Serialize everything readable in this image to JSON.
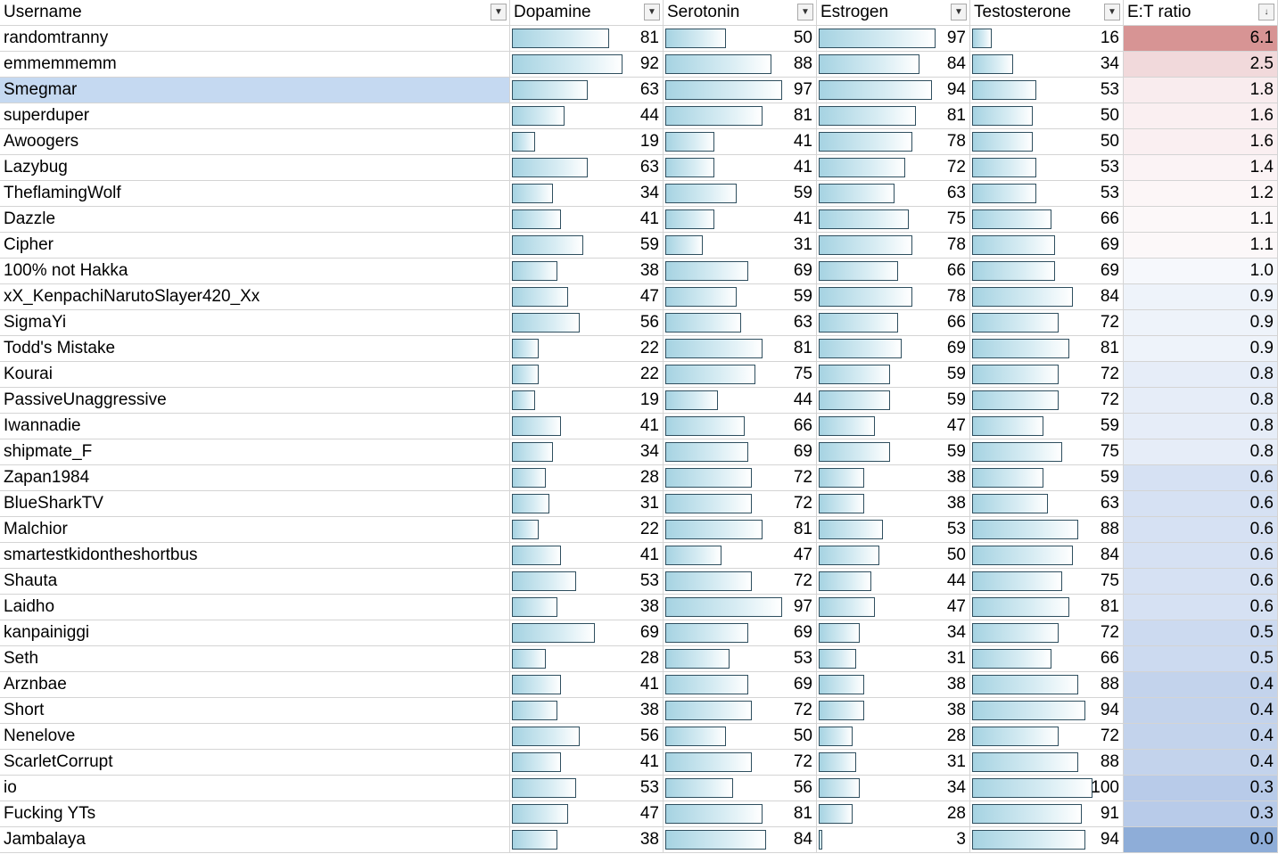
{
  "headers": {
    "username": "Username",
    "dopamine": "Dopamine",
    "serotonin": "Serotonin",
    "estrogen": "Estrogen",
    "testosterone": "Testosterone",
    "ratio": "E:T ratio"
  },
  "icons": {
    "filter": "dropdown-arrow-icon",
    "sort_desc": "sort-descending-icon"
  },
  "colors": {
    "selected_row": "#c5d9f1",
    "ratio_high": "#d79494",
    "ratio_mid": "#fbf8f9",
    "ratio_low": "#8eadd8"
  },
  "rows": [
    {
      "user": "randomtranny",
      "dopamine": 81,
      "serotonin": 50,
      "estrogen": 97,
      "testosterone": 16,
      "ratio": "6.1",
      "ratio_color": "#d79494"
    },
    {
      "user": "emmemmemm",
      "dopamine": 92,
      "serotonin": 88,
      "estrogen": 84,
      "testosterone": 34,
      "ratio": "2.5",
      "ratio_color": "#f1d9db"
    },
    {
      "user": "Smegmar",
      "dopamine": 63,
      "serotonin": 97,
      "estrogen": 94,
      "testosterone": 53,
      "ratio": "1.8",
      "ratio_color": "#f9ecee",
      "selected": true
    },
    {
      "user": "superduper",
      "dopamine": 44,
      "serotonin": 81,
      "estrogen": 81,
      "testosterone": 50,
      "ratio": "1.6",
      "ratio_color": "#faeff1"
    },
    {
      "user": "Awoogers",
      "dopamine": 19,
      "serotonin": 41,
      "estrogen": 78,
      "testosterone": 50,
      "ratio": "1.6",
      "ratio_color": "#faeff1"
    },
    {
      "user": "Lazybug",
      "dopamine": 63,
      "serotonin": 41,
      "estrogen": 72,
      "testosterone": 53,
      "ratio": "1.4",
      "ratio_color": "#fbf3f5"
    },
    {
      "user": "TheflamingWolf",
      "dopamine": 34,
      "serotonin": 59,
      "estrogen": 63,
      "testosterone": 53,
      "ratio": "1.2",
      "ratio_color": "#fcf6f7"
    },
    {
      "user": "Dazzle",
      "dopamine": 41,
      "serotonin": 41,
      "estrogen": 75,
      "testosterone": 66,
      "ratio": "1.1",
      "ratio_color": "#fcf8f9"
    },
    {
      "user": "Cipher",
      "dopamine": 59,
      "serotonin": 31,
      "estrogen": 78,
      "testosterone": 69,
      "ratio": "1.1",
      "ratio_color": "#fcf8f9"
    },
    {
      "user": "100% not Hakka",
      "dopamine": 38,
      "serotonin": 69,
      "estrogen": 66,
      "testosterone": 69,
      "ratio": "1.0",
      "ratio_color": "#f6f8fc"
    },
    {
      "user": "xX_KenpachiNarutoSlayer420_Xx",
      "dopamine": 47,
      "serotonin": 59,
      "estrogen": 78,
      "testosterone": 84,
      "ratio": "0.9",
      "ratio_color": "#eef3fa"
    },
    {
      "user": "SigmaYi",
      "dopamine": 56,
      "serotonin": 63,
      "estrogen": 66,
      "testosterone": 72,
      "ratio": "0.9",
      "ratio_color": "#eef3fa"
    },
    {
      "user": "Todd's Mistake",
      "dopamine": 22,
      "serotonin": 81,
      "estrogen": 69,
      "testosterone": 81,
      "ratio": "0.9",
      "ratio_color": "#eef3fa"
    },
    {
      "user": "Kourai",
      "dopamine": 22,
      "serotonin": 75,
      "estrogen": 59,
      "testosterone": 72,
      "ratio": "0.8",
      "ratio_color": "#e6edf8"
    },
    {
      "user": "PassiveUnaggressive",
      "dopamine": 19,
      "serotonin": 44,
      "estrogen": 59,
      "testosterone": 72,
      "ratio": "0.8",
      "ratio_color": "#e6edf8"
    },
    {
      "user": "Iwannadie",
      "dopamine": 41,
      "serotonin": 66,
      "estrogen": 47,
      "testosterone": 59,
      "ratio": "0.8",
      "ratio_color": "#e6edf8"
    },
    {
      "user": "shipmate_F",
      "dopamine": 34,
      "serotonin": 69,
      "estrogen": 59,
      "testosterone": 75,
      "ratio": "0.8",
      "ratio_color": "#e6edf8"
    },
    {
      "user": "Zapan1984",
      "dopamine": 28,
      "serotonin": 72,
      "estrogen": 38,
      "testosterone": 59,
      "ratio": "0.6",
      "ratio_color": "#d6e1f3"
    },
    {
      "user": "BlueSharkTV",
      "dopamine": 31,
      "serotonin": 72,
      "estrogen": 38,
      "testosterone": 63,
      "ratio": "0.6",
      "ratio_color": "#d6e1f3"
    },
    {
      "user": "Malchior",
      "dopamine": 22,
      "serotonin": 81,
      "estrogen": 53,
      "testosterone": 88,
      "ratio": "0.6",
      "ratio_color": "#d6e1f3"
    },
    {
      "user": "smartestkidontheshortbus",
      "dopamine": 41,
      "serotonin": 47,
      "estrogen": 50,
      "testosterone": 84,
      "ratio": "0.6",
      "ratio_color": "#d6e1f3"
    },
    {
      "user": "Shauta",
      "dopamine": 53,
      "serotonin": 72,
      "estrogen": 44,
      "testosterone": 75,
      "ratio": "0.6",
      "ratio_color": "#d6e1f3"
    },
    {
      "user": "Laidho",
      "dopamine": 38,
      "serotonin": 97,
      "estrogen": 47,
      "testosterone": 81,
      "ratio": "0.6",
      "ratio_color": "#d6e1f3"
    },
    {
      "user": "kanpainiggi",
      "dopamine": 69,
      "serotonin": 69,
      "estrogen": 34,
      "testosterone": 72,
      "ratio": "0.5",
      "ratio_color": "#ccdaf0"
    },
    {
      "user": "Seth",
      "dopamine": 28,
      "serotonin": 53,
      "estrogen": 31,
      "testosterone": 66,
      "ratio": "0.5",
      "ratio_color": "#ccdaf0"
    },
    {
      "user": "Arznbae",
      "dopamine": 41,
      "serotonin": 69,
      "estrogen": 38,
      "testosterone": 88,
      "ratio": "0.4",
      "ratio_color": "#c3d3ec"
    },
    {
      "user": "Short",
      "dopamine": 38,
      "serotonin": 72,
      "estrogen": 38,
      "testosterone": 94,
      "ratio": "0.4",
      "ratio_color": "#c3d3ec"
    },
    {
      "user": "Nenelove",
      "dopamine": 56,
      "serotonin": 50,
      "estrogen": 28,
      "testosterone": 72,
      "ratio": "0.4",
      "ratio_color": "#c3d3ec"
    },
    {
      "user": "ScarletCorrupt",
      "dopamine": 41,
      "serotonin": 72,
      "estrogen": 31,
      "testosterone": 88,
      "ratio": "0.4",
      "ratio_color": "#c3d3ec"
    },
    {
      "user": "io",
      "dopamine": 53,
      "serotonin": 56,
      "estrogen": 34,
      "testosterone": 100,
      "ratio": "0.3",
      "ratio_color": "#b8cbe9"
    },
    {
      "user": "Fucking YTs",
      "dopamine": 47,
      "serotonin": 81,
      "estrogen": 28,
      "testosterone": 91,
      "ratio": "0.3",
      "ratio_color": "#b8cbe9"
    },
    {
      "user": "Jambalaya",
      "dopamine": 38,
      "serotonin": 84,
      "estrogen": 3,
      "testosterone": 94,
      "ratio": "0.0",
      "ratio_color": "#8eadd8"
    }
  ]
}
